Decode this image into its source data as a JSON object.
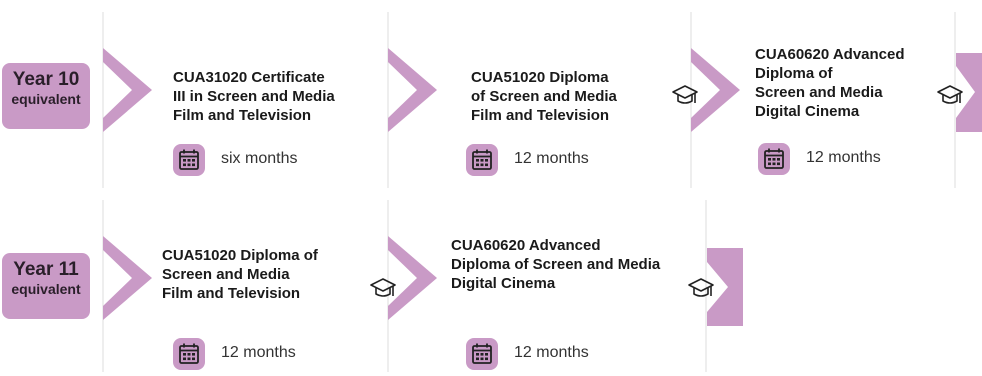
{
  "colors": {
    "accent": "#c99ac6",
    "arrow_fill": "#c99ac6",
    "divider": "#dddddd",
    "text": "#1a1a1a"
  },
  "rows": [
    {
      "badge": {
        "year": "Year 10",
        "equivalent": "equivalent"
      },
      "steps": [
        {
          "title": [
            "CUA31020 Certificate",
            "III in Screen and Media",
            "Film and Television"
          ],
          "duration": "six months",
          "icon": "calendar-icon"
        },
        {
          "title": [
            "CUA51020 Diploma",
            "of Screen and Media",
            "Film and Television"
          ],
          "duration": "12 months",
          "icon": "calendar-icon"
        },
        {
          "title": [
            "CUA60620 Advanced",
            "Diploma of",
            "Screen and Media",
            "Digital Cinema"
          ],
          "duration": "12 months",
          "icon": "calendar-icon"
        }
      ],
      "connector_icon": "graduation-cap-icon"
    },
    {
      "badge": {
        "year": "Year 11",
        "equivalent": "equivalent"
      },
      "steps": [
        {
          "title": [
            "CUA51020 Diploma of",
            "Screen and Media",
            "Film and Television"
          ],
          "duration": "12 months",
          "icon": "calendar-icon"
        },
        {
          "title": [
            "CUA60620 Advanced",
            "Diploma of Screen and Media",
            "Digital Cinema"
          ],
          "duration": "12 months",
          "icon": "calendar-icon"
        }
      ],
      "connector_icon": "graduation-cap-icon"
    }
  ]
}
